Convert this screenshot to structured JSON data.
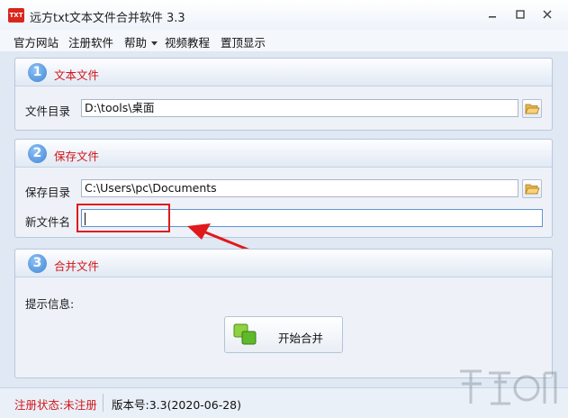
{
  "window": {
    "title": "远方txt文本文件合并软件 3.3",
    "app_icon_text": "TXT"
  },
  "menu": {
    "items": [
      "官方网站",
      "注册软件",
      "帮助",
      "视频教程",
      "置顶显示"
    ]
  },
  "section1": {
    "number": "1",
    "title": "文本文件",
    "dir_label": "文件目录",
    "dir_value": "D:\\tools\\桌面"
  },
  "section2": {
    "number": "2",
    "title": "保存文件",
    "dir_label": "保存目录",
    "dir_value": "C:\\Users\\pc\\Documents",
    "filename_label": "新文件名",
    "filename_value": ""
  },
  "section3": {
    "number": "3",
    "title": "合并文件",
    "info_label": "提示信息:",
    "merge_button": "开始合并"
  },
  "status": {
    "registration": "注册状态:未注册",
    "version": "版本号:3.3(2020-06-28)"
  },
  "colors": {
    "accent_red": "#d3141a",
    "badge_blue": "#3f86d6",
    "annotation_red": "#e0191b"
  }
}
